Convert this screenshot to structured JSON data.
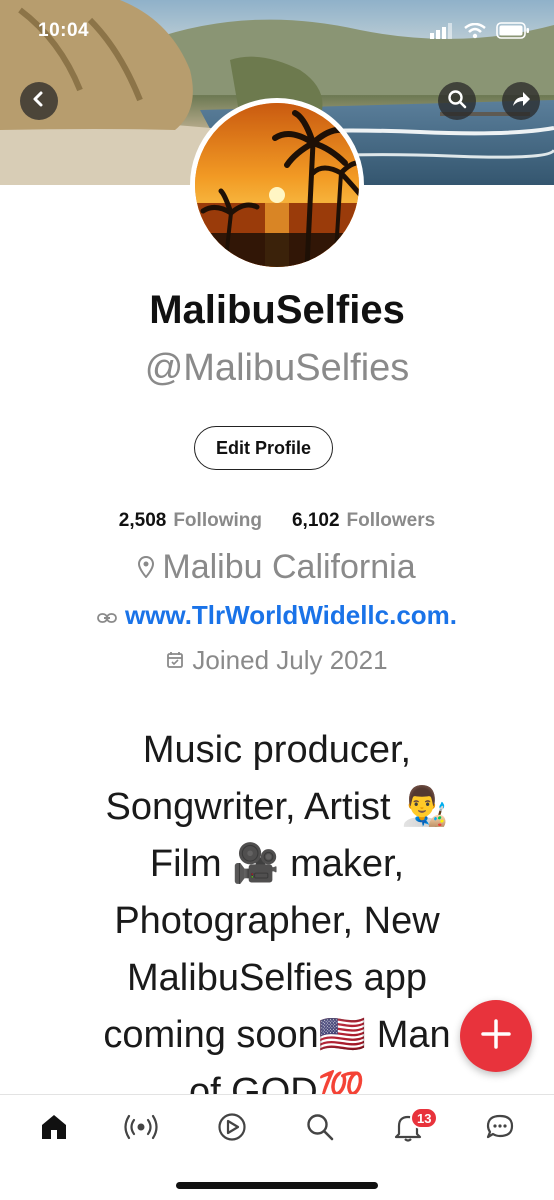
{
  "status_bar": {
    "time": "10:04",
    "icons": [
      "cellular-signal-icon",
      "wifi-icon",
      "battery-icon"
    ]
  },
  "header": {
    "back_icon": "chevron-left-icon",
    "search_icon": "search-icon",
    "share_icon": "share-arrow-icon"
  },
  "profile": {
    "display_name": "MalibuSelfies",
    "handle": "@MalibuSelfies",
    "edit_label": "Edit Profile",
    "following_count": "2,508",
    "following_label": "Following",
    "followers_count": "6,102",
    "followers_label": "Followers",
    "location": "Malibu California",
    "website": "www.TlrWorldWidellc.com.",
    "joined": "Joined July 2021",
    "bio_lines": [
      "Music producer,",
      "Songwriter, Artist 👨‍🎨",
      "Film 🎥 maker,",
      "Photographer, New",
      "MalibuSelfies app",
      "coming soon🇺🇸 Man",
      "of GOD💯"
    ]
  },
  "fab": {
    "icon": "plus-icon"
  },
  "tabbar": {
    "items": [
      "home-icon",
      "spaces-broadcast-icon",
      "video-play-icon",
      "search-icon",
      "notifications-bell-icon",
      "messages-icon"
    ],
    "notification_badge": "13"
  },
  "colors": {
    "accent_red": "#e8333c",
    "link_blue": "#1a73e8",
    "muted_gray": "#8a8a8a"
  }
}
